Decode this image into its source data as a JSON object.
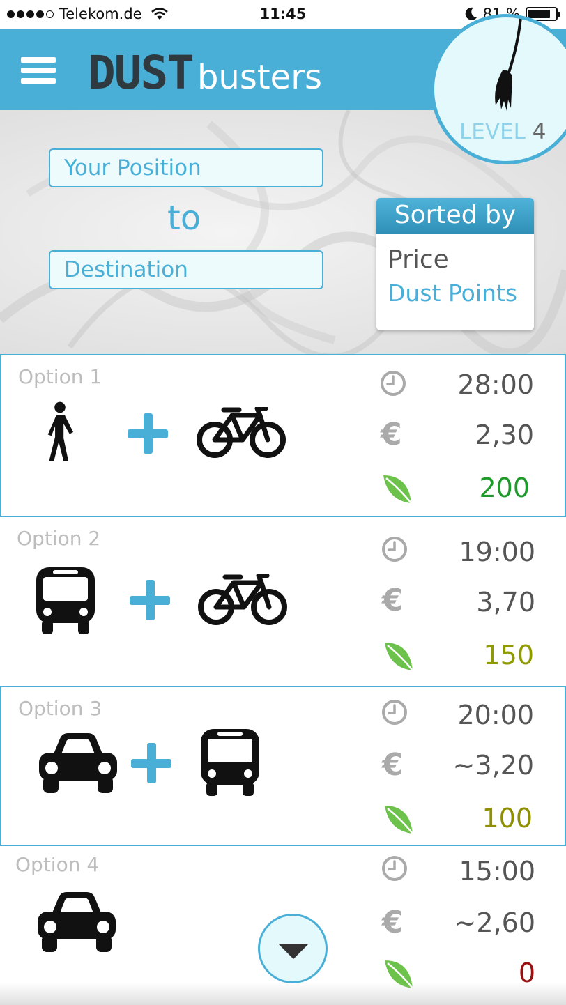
{
  "status_bar": {
    "carrier": "Telekom.de",
    "time": "11:45",
    "battery": "81 %",
    "battery_level": 0.81
  },
  "header": {
    "logo_dust": "DUST",
    "logo_busters": "busters",
    "level_label": "LEVEL",
    "level_value": "4"
  },
  "route": {
    "from_value": "Your Position",
    "to_label": "to",
    "destination_value": "Destination"
  },
  "sort": {
    "title": "Sorted by",
    "options": [
      "Price",
      "Dust Points"
    ]
  },
  "options": [
    {
      "label": "Option 1",
      "modes": [
        "walk-icon",
        "bike-icon"
      ],
      "time": "28:00",
      "price": "2,30",
      "points": "200",
      "points_color": "#1e9a2a"
    },
    {
      "label": "Option 2",
      "modes": [
        "bus-icon",
        "bike-icon"
      ],
      "time": "19:00",
      "price": "3,70",
      "points": "150",
      "points_color": "#8f9a00"
    },
    {
      "label": "Option 3",
      "modes": [
        "car-icon",
        "bus-icon"
      ],
      "time": "20:00",
      "price": "~3,20",
      "points": "100",
      "points_color": "#8f9000"
    },
    {
      "label": "Option 4",
      "modes": [
        "car-icon"
      ],
      "time": "15:00",
      "price": "~2,60",
      "points": "0",
      "points_color": "#9a1010"
    }
  ],
  "colors": {
    "accent": "#4aafd7",
    "leaf": "#6cc24a"
  }
}
